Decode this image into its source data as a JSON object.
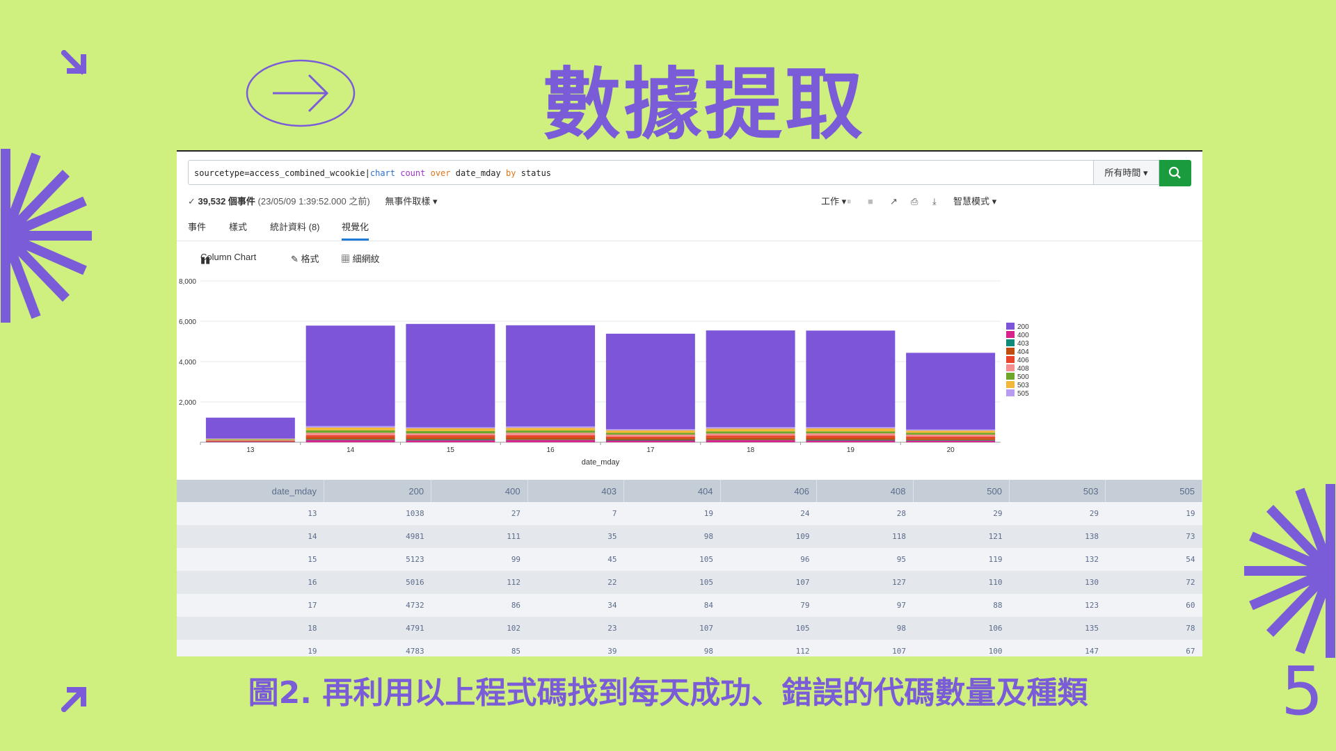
{
  "slide": {
    "title": "數據提取",
    "caption": "圖2. 再利用以上程式碼找到每天成功、錯誤的代碼數量及種類",
    "page_number": "5",
    "accent": "#7a5bd8",
    "background": "#cff07f"
  },
  "search": {
    "query_base": "sourcetype=access_combined_wcookie|",
    "query_cmd": "chart",
    "query_fn": "count",
    "query_op1": "over",
    "query_field1": "date_mday",
    "query_op2": "by",
    "query_field2": "status",
    "time_range": "所有時間 ▾",
    "search_icon": "search-icon"
  },
  "status": {
    "check": "✓",
    "count_label": "39,532 個事件",
    "timestamp": "(23/05/09 1:39:52.000 之前)",
    "sampling": "無事件取樣 ▾",
    "job": "工作 ▾",
    "mode": "智慧模式 ▾"
  },
  "tabs": [
    "事件",
    "樣式",
    "統計資料 (8)",
    "視覺化"
  ],
  "viz_toolbar": {
    "chart_type": "Column Chart",
    "format": "格式",
    "trellis": "細網紋"
  },
  "chart_data": {
    "type": "bar",
    "stacked": true,
    "xlabel": "date_mday",
    "ylabel": "",
    "ylim": [
      0,
      8000
    ],
    "yticks": [
      "8,000",
      "6,000",
      "4,000",
      "2,000"
    ],
    "categories": [
      "13",
      "14",
      "15",
      "16",
      "17",
      "18",
      "19",
      "20"
    ],
    "legend_position": "right",
    "series": [
      {
        "name": "200",
        "color": "#7c55d9",
        "values": [
          1038,
          4981,
          5123,
          5016,
          4732,
          4791,
          4783,
          3800
        ]
      },
      {
        "name": "400",
        "color": "#d6248b",
        "values": [
          27,
          111,
          99,
          112,
          86,
          102,
          85,
          80
        ]
      },
      {
        "name": "403",
        "color": "#0f8a7a",
        "values": [
          7,
          35,
          45,
          22,
          34,
          23,
          39,
          30
        ]
      },
      {
        "name": "404",
        "color": "#c04d0d",
        "values": [
          19,
          98,
          105,
          105,
          84,
          107,
          98,
          85
        ]
      },
      {
        "name": "406",
        "color": "#e8452c",
        "values": [
          24,
          109,
          96,
          107,
          79,
          105,
          112,
          90
        ]
      },
      {
        "name": "408",
        "color": "#f38f8f",
        "values": [
          28,
          118,
          95,
          127,
          97,
          98,
          107,
          95
        ]
      },
      {
        "name": "500",
        "color": "#6ea62c",
        "values": [
          29,
          121,
          119,
          110,
          88,
          106,
          100,
          90
        ]
      },
      {
        "name": "503",
        "color": "#f3b73a",
        "values": [
          29,
          138,
          132,
          130,
          123,
          135,
          147,
          110
        ]
      },
      {
        "name": "505",
        "color": "#b79cf0",
        "values": [
          19,
          73,
          54,
          72,
          60,
          78,
          67,
          55
        ]
      }
    ]
  },
  "table": {
    "headers": [
      "date_mday",
      "200",
      "400",
      "403",
      "404",
      "406",
      "408",
      "500",
      "503",
      "505"
    ],
    "rows": [
      [
        "13",
        "1038",
        "27",
        "7",
        "19",
        "24",
        "28",
        "29",
        "29",
        "19"
      ],
      [
        "14",
        "4981",
        "111",
        "35",
        "98",
        "109",
        "118",
        "121",
        "138",
        "73"
      ],
      [
        "15",
        "5123",
        "99",
        "45",
        "105",
        "96",
        "95",
        "119",
        "132",
        "54"
      ],
      [
        "16",
        "5016",
        "112",
        "22",
        "105",
        "107",
        "127",
        "110",
        "130",
        "72"
      ],
      [
        "17",
        "4732",
        "86",
        "34",
        "84",
        "79",
        "97",
        "88",
        "123",
        "60"
      ],
      [
        "18",
        "4791",
        "102",
        "23",
        "107",
        "105",
        "98",
        "106",
        "135",
        "78"
      ],
      [
        "19",
        "4783",
        "85",
        "39",
        "98",
        "112",
        "107",
        "100",
        "147",
        "67"
      ]
    ]
  }
}
